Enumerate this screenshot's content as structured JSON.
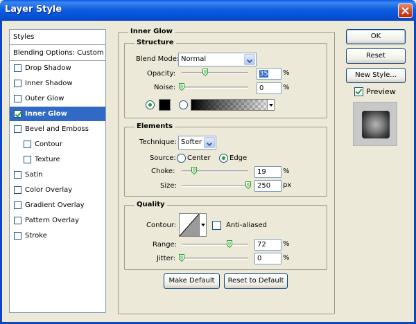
{
  "window": {
    "title": "Layer Style"
  },
  "styles": {
    "header": "Styles",
    "blending": "Blending Options: Custom",
    "items": [
      {
        "label": "Drop Shadow",
        "checked": false,
        "sub": false
      },
      {
        "label": "Inner Shadow",
        "checked": false,
        "sub": false
      },
      {
        "label": "Outer Glow",
        "checked": false,
        "sub": false
      },
      {
        "label": "Inner Glow",
        "checked": true,
        "sub": false,
        "selected": true
      },
      {
        "label": "Bevel and Emboss",
        "checked": false,
        "sub": false
      },
      {
        "label": "Contour",
        "checked": false,
        "sub": true
      },
      {
        "label": "Texture",
        "checked": false,
        "sub": true
      },
      {
        "label": "Satin",
        "checked": false,
        "sub": false
      },
      {
        "label": "Color Overlay",
        "checked": false,
        "sub": false
      },
      {
        "label": "Gradient Overlay",
        "checked": false,
        "sub": false
      },
      {
        "label": "Pattern Overlay",
        "checked": false,
        "sub": false
      },
      {
        "label": "Stroke",
        "checked": false,
        "sub": false
      }
    ]
  },
  "inner_glow": {
    "title": "Inner Glow",
    "structure": {
      "title": "Structure",
      "blend_mode_label": "Blend Mode:",
      "blend_mode_value": "Normal",
      "opacity_label": "Opacity:",
      "opacity_value": "35",
      "opacity_fraction": 0.35,
      "noise_label": "Noise:",
      "noise_value": "0",
      "noise_fraction": 0.0,
      "unit_percent": "%"
    },
    "elements": {
      "title": "Elements",
      "technique_label": "Technique:",
      "technique_value": "Softer",
      "source_label": "Source:",
      "source_center": "Center",
      "source_edge": "Edge",
      "choke_label": "Choke:",
      "choke_value": "19",
      "choke_fraction": 0.19,
      "size_label": "Size:",
      "size_value": "250",
      "size_fraction": 1.0,
      "unit_px": "px"
    },
    "quality": {
      "title": "Quality",
      "contour_label": "Contour:",
      "anti_aliased_label": "Anti-aliased",
      "range_label": "Range:",
      "range_value": "72",
      "range_fraction": 0.72,
      "jitter_label": "Jitter:",
      "jitter_value": "0",
      "jitter_fraction": 0.0
    },
    "make_default": "Make Default",
    "reset_default": "Reset to Default"
  },
  "actions": {
    "ok": "OK",
    "reset": "Reset",
    "new_style": "New Style...",
    "preview": "Preview"
  },
  "colors": {
    "titlebar": "#0A5AE8",
    "selection": "#316AC5",
    "face": "#ECE9D8",
    "glow_color": "#000000"
  }
}
